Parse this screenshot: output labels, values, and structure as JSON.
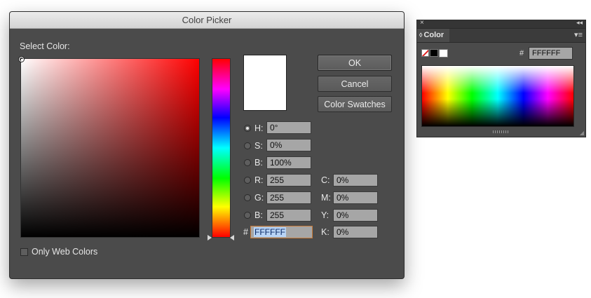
{
  "dialog": {
    "title": "Color Picker",
    "select_color_label": "Select Color:",
    "buttons": {
      "ok": "OK",
      "cancel": "Cancel",
      "swatches": "Color Swatches"
    },
    "fields": {
      "h": {
        "label": "H:",
        "value": "0°"
      },
      "s": {
        "label": "S:",
        "value": "0%"
      },
      "b": {
        "label": "B:",
        "value": "100%"
      },
      "r": {
        "label": "R:",
        "value": "255"
      },
      "g": {
        "label": "G:",
        "value": "255"
      },
      "b2": {
        "label": "B:",
        "value": "255"
      },
      "c": {
        "label": "C:",
        "value": "0%"
      },
      "m": {
        "label": "M:",
        "value": "0%"
      },
      "y": {
        "label": "Y:",
        "value": "0%"
      },
      "k": {
        "label": "K:",
        "value": "0%"
      },
      "hex_symbol": "#",
      "hex_value": "FFFFFF"
    },
    "selected_mode": "H",
    "current_color": "#ffffff",
    "only_web_colors": {
      "label": "Only Web Colors",
      "checked": false
    }
  },
  "panel": {
    "tab_label": "Color",
    "tab_arrows": "◊",
    "close_icon": "×",
    "collapse_icon": "◂◂",
    "menu_icon": "▾≡",
    "hex_symbol": "#",
    "hex_value": "FFFFFF",
    "fill_color": "#ffffff"
  }
}
